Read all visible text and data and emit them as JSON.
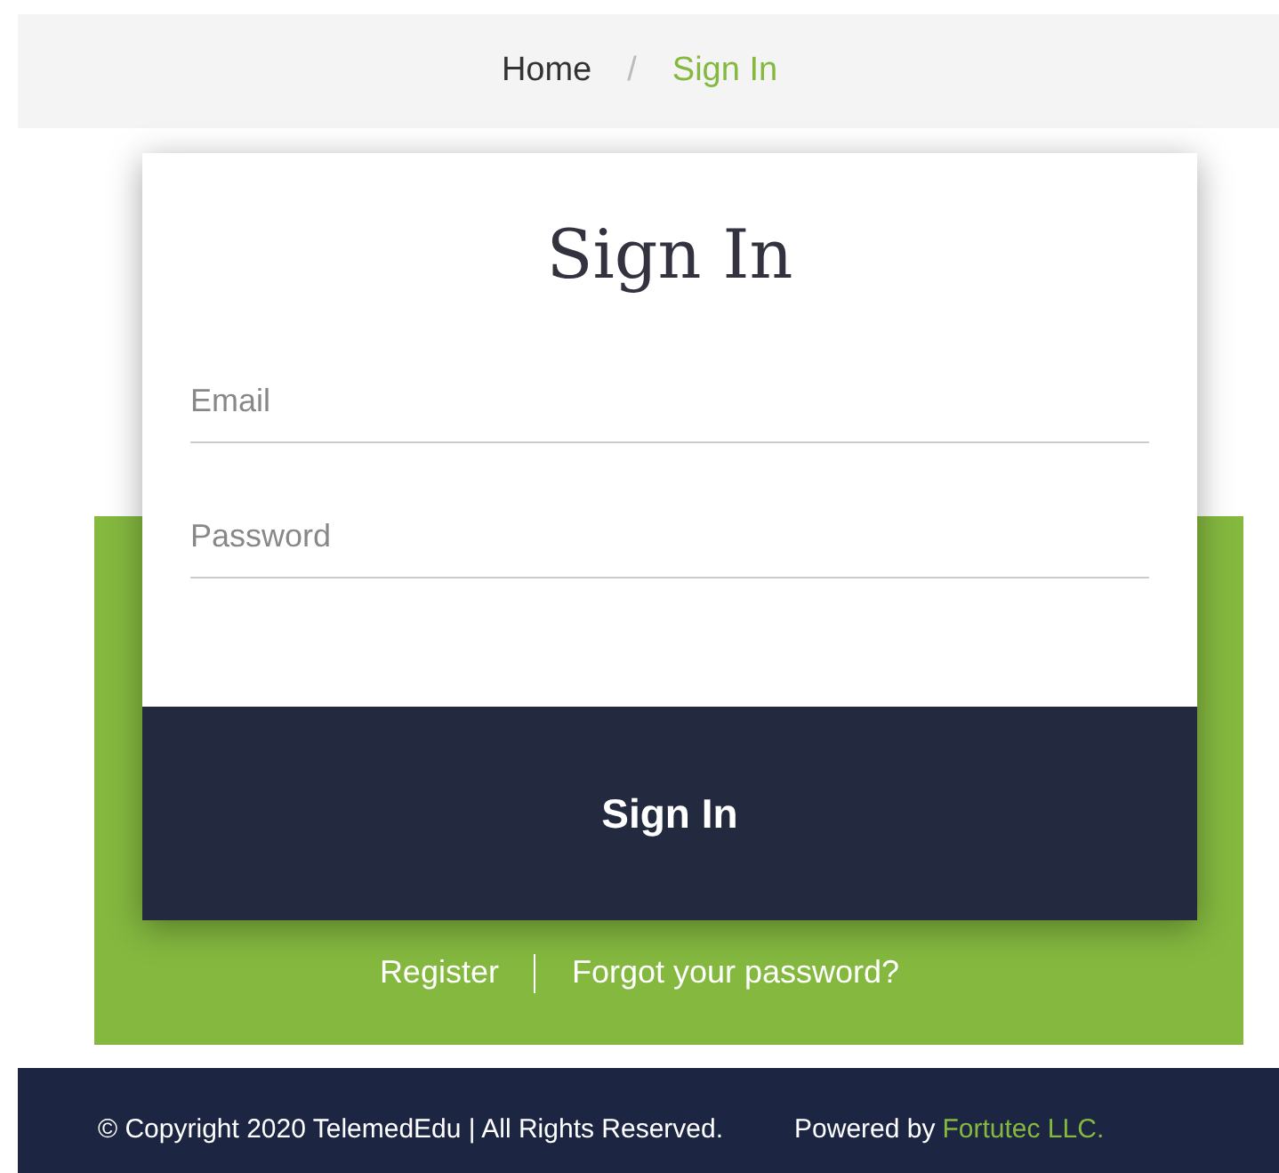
{
  "breadcrumb": [
    {
      "label": "Home",
      "selected": false
    },
    {
      "separator": "/",
      "label": "Sign In",
      "selected": true
    }
  ],
  "form": {
    "title": "Sign In",
    "fields": [
      {
        "placeholder": "Email"
      },
      {
        "placeholder": "Password"
      }
    ],
    "submit": "Sign In"
  },
  "links": [
    "Register",
    "Forgot your password?"
  ],
  "footer": {
    "copyright": "© Copyright 2020 TelemedEdu | All Rights Reserved.",
    "powered_by": "Powered by",
    "company": "Fortutec LLC."
  }
}
